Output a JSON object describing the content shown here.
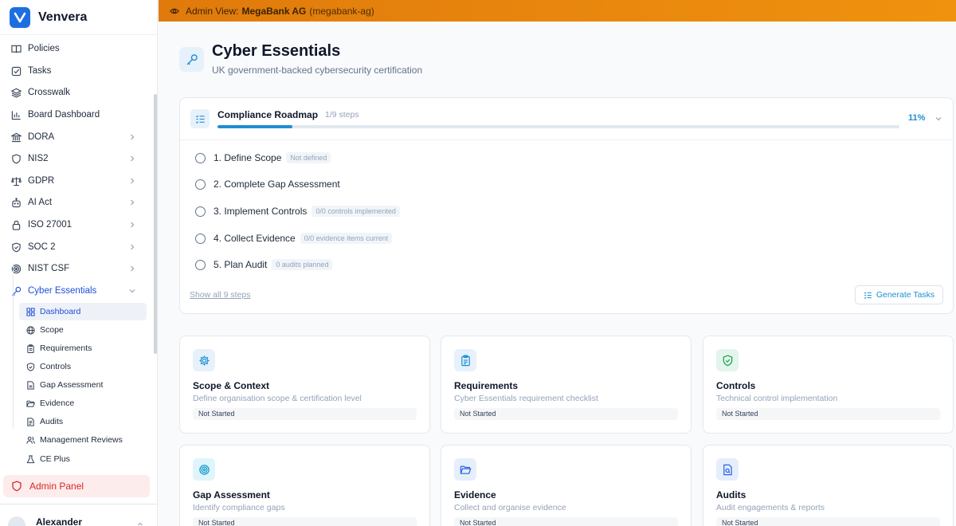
{
  "brand": {
    "name": "Venvera"
  },
  "banner": {
    "prefix": "Admin View:",
    "org": "MegaBank AG",
    "slug": "(megabank-ag)"
  },
  "sidebar": {
    "items": [
      {
        "label": "Policies"
      },
      {
        "label": "Tasks"
      },
      {
        "label": "Crosswalk"
      },
      {
        "label": "Board Dashboard"
      },
      {
        "label": "DORA"
      },
      {
        "label": "NIS2"
      },
      {
        "label": "GDPR"
      },
      {
        "label": "AI Act"
      },
      {
        "label": "ISO 27001"
      },
      {
        "label": "SOC 2"
      },
      {
        "label": "NIST CSF"
      },
      {
        "label": "Cyber Essentials"
      }
    ],
    "subitems": [
      {
        "label": "Dashboard"
      },
      {
        "label": "Scope"
      },
      {
        "label": "Requirements"
      },
      {
        "label": "Controls"
      },
      {
        "label": "Gap Assessment"
      },
      {
        "label": "Evidence"
      },
      {
        "label": "Audits"
      },
      {
        "label": "Management Reviews"
      },
      {
        "label": "CE Plus"
      }
    ],
    "admin_panel": "Admin Panel",
    "user_name": "Alexander"
  },
  "page": {
    "title": "Cyber Essentials",
    "subtitle": "UK government-backed cybersecurity certification"
  },
  "roadmap": {
    "title": "Compliance Roadmap",
    "steps_count": "1/9 steps",
    "percent_label": "11%",
    "progress": 0.11,
    "steps": [
      {
        "label": "1. Define Scope",
        "badge": "Not defined"
      },
      {
        "label": "2. Complete Gap Assessment",
        "badge": ""
      },
      {
        "label": "3. Implement Controls",
        "badge": "0/0 controls implemented"
      },
      {
        "label": "4. Collect Evidence",
        "badge": "0/0 evidence items current"
      },
      {
        "label": "5. Plan Audit",
        "badge": "0 audits planned"
      }
    ],
    "show_all": "Show all 9 steps",
    "generate_tasks": "Generate Tasks"
  },
  "cards": [
    {
      "title": "Scope & Context",
      "desc": "Define organisation scope & certification level",
      "status": "Not Started",
      "icon": "gear-icon",
      "tint": "#e6f1fb"
    },
    {
      "title": "Requirements",
      "desc": "Cyber Essentials requirement checklist",
      "status": "Not Started",
      "icon": "clipboard-icon",
      "tint": "#e6f1fb"
    },
    {
      "title": "Controls",
      "desc": "Technical control implementation",
      "status": "Not Started",
      "icon": "shield-check-icon",
      "tint": "#e3f5ec"
    },
    {
      "title": "Gap Assessment",
      "desc": "Identify compliance gaps",
      "status": "Not Started",
      "icon": "target-icon",
      "tint": "#e0f4fb"
    },
    {
      "title": "Evidence",
      "desc": "Collect and organise evidence",
      "status": "Not Started",
      "icon": "folder-icon",
      "tint": "#e6eefb"
    },
    {
      "title": "Audits",
      "desc": "Audit engagements & reports",
      "status": "Not Started",
      "icon": "document-search-icon",
      "tint": "#e6eefb"
    }
  ],
  "colors": {
    "accent": "#1d8fd2",
    "brand": "#1d6fe0",
    "banner": "#e88610",
    "danger": "#dc2626"
  }
}
